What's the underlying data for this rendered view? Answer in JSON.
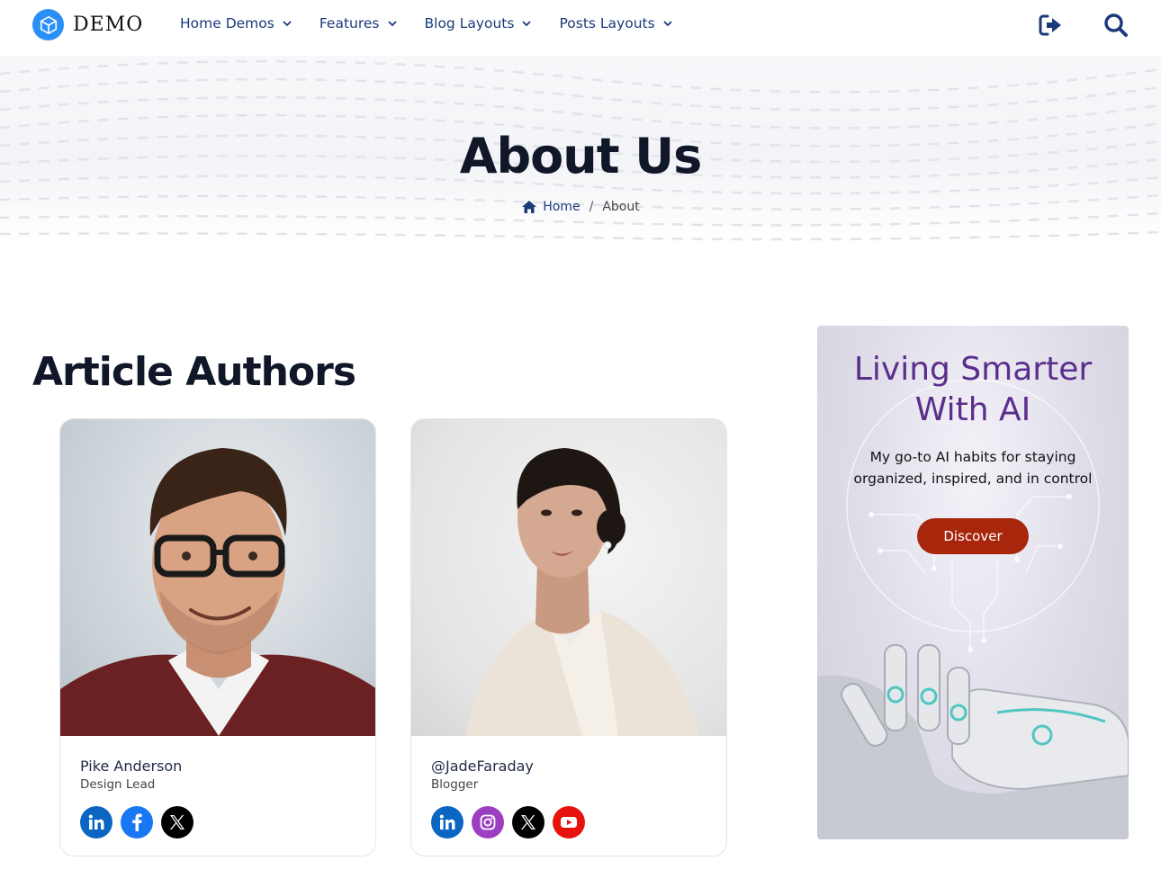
{
  "brand": {
    "name": "DEMO",
    "accent": "#2a8ff7"
  },
  "nav": {
    "items": [
      {
        "label": "Home Demos"
      },
      {
        "label": "Features"
      },
      {
        "label": "Blog Layouts"
      },
      {
        "label": "Posts Layouts"
      }
    ],
    "icons": [
      "sign-in-icon",
      "search-icon"
    ]
  },
  "hero": {
    "title": "About Us",
    "breadcrumb": {
      "home": "Home",
      "separator": "/",
      "current": "About"
    }
  },
  "section": {
    "title": "Article Authors",
    "authors": [
      {
        "name": "Pike Anderson",
        "role": "Design Lead",
        "socials": [
          "linkedin-icon",
          "facebook-icon",
          "x-icon"
        ]
      },
      {
        "name": "@JadeFaraday",
        "role": "Blogger",
        "socials": [
          "linkedin-icon",
          "instagram-icon",
          "x-icon",
          "youtube-icon"
        ]
      }
    ]
  },
  "ad": {
    "title_line1": "Living Smarter",
    "title_line2": "With AI",
    "subtitle": "My go-to AI habits for staying organized, inspired, and in control",
    "button": "Discover",
    "button_color": "#a7260c",
    "title_color": "#5a2e8c"
  },
  "colors": {
    "nav_text": "#1b3a7a",
    "linkedin": "#0a66c2",
    "facebook": "#1877f2",
    "instagram": "#9b3fc0",
    "x": "#000000",
    "youtube": "#e8120c"
  }
}
